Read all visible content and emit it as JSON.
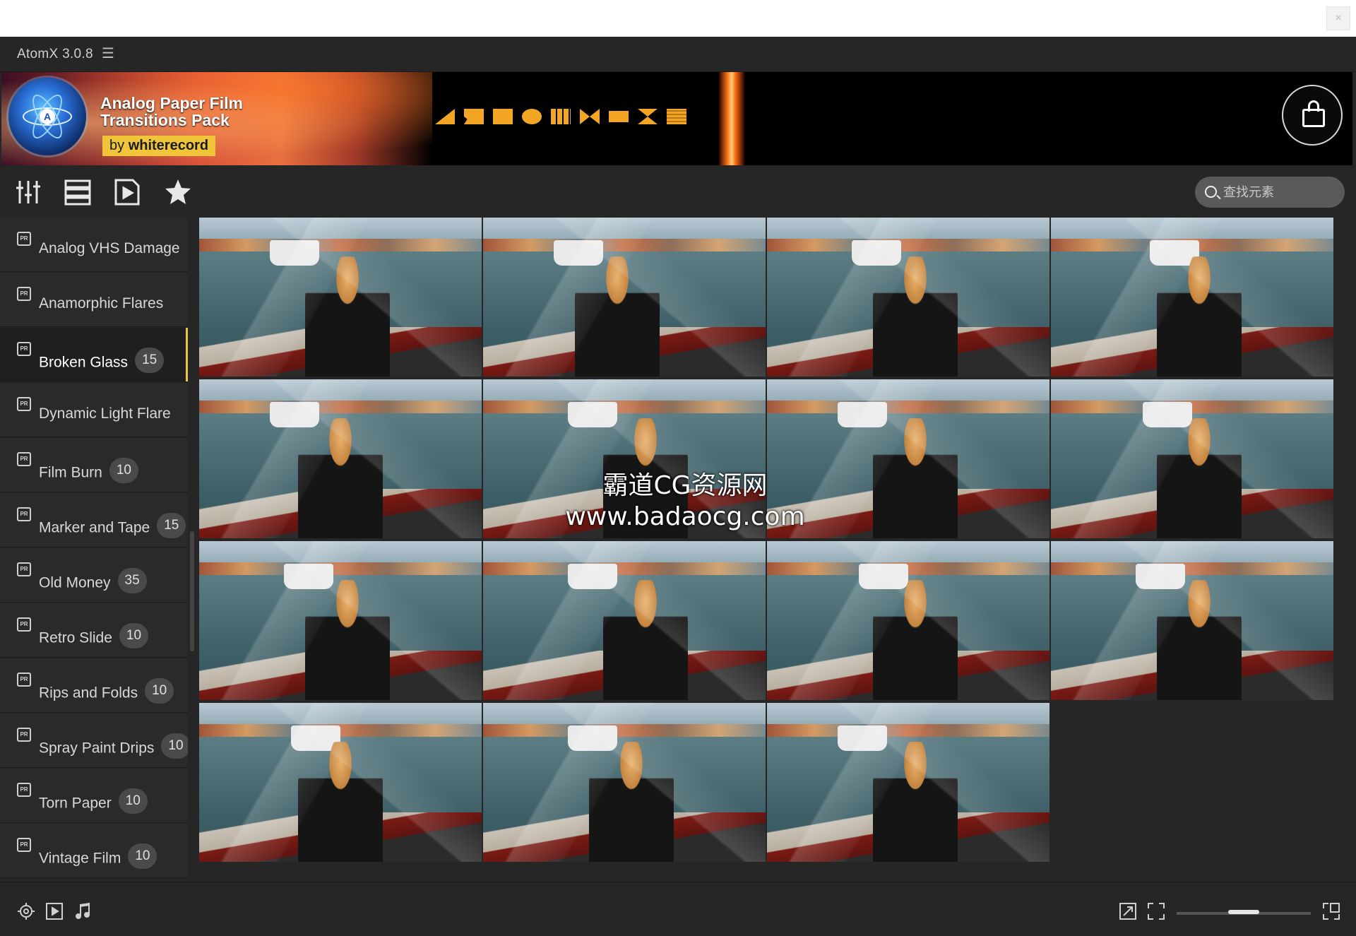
{
  "app": {
    "title": "AtomX 3.0.8",
    "menu_icon": "hamburger-icon",
    "close_icon": "close-icon",
    "close_glyph": "×"
  },
  "banner": {
    "title_line1": "Analog Paper Film",
    "title_line2": "Transitions Pack",
    "by_prefix": "by",
    "by_name": "whiterecord",
    "accent_color": "#f0c53a",
    "logo_letter": "A",
    "cart_icon": "shopping-bag-icon"
  },
  "toolbar": {
    "icons": [
      "sliders-icon",
      "list-icon",
      "play-file-icon",
      "star-icon"
    ],
    "search": {
      "placeholder": "查找元素",
      "value": ""
    }
  },
  "sidebar": {
    "items": [
      {
        "label": "Analog VHS Damage",
        "count": ""
      },
      {
        "label": "Anamorphic Flares",
        "count": ""
      },
      {
        "label": "Broken Glass",
        "count": "15",
        "active": true
      },
      {
        "label": "Dynamic Light Flare",
        "count": ""
      },
      {
        "label": "Film Burn",
        "count": "10"
      },
      {
        "label": "Marker and Tape",
        "count": "15"
      },
      {
        "label": "Old Money",
        "count": "35"
      },
      {
        "label": "Retro Slide",
        "count": "10"
      },
      {
        "label": "Rips and Folds",
        "count": "10"
      },
      {
        "label": "Spray Paint Drips",
        "count": "10"
      },
      {
        "label": "Torn Paper",
        "count": "10"
      },
      {
        "label": "Vintage Film",
        "count": "10"
      }
    ]
  },
  "grid": {
    "thumbnail_count": 15,
    "columns": 4
  },
  "watermark": {
    "line1": "霸道CG资源网",
    "line2": "www.badaocg.com"
  },
  "statusbar": {
    "left_icons": [
      "target-icon",
      "play-box-icon",
      "music-note-icon"
    ],
    "right_icons": [
      "resize-icon",
      "fullscreen-icon",
      "expand-window-icon"
    ],
    "zoom_level": 0.5
  }
}
